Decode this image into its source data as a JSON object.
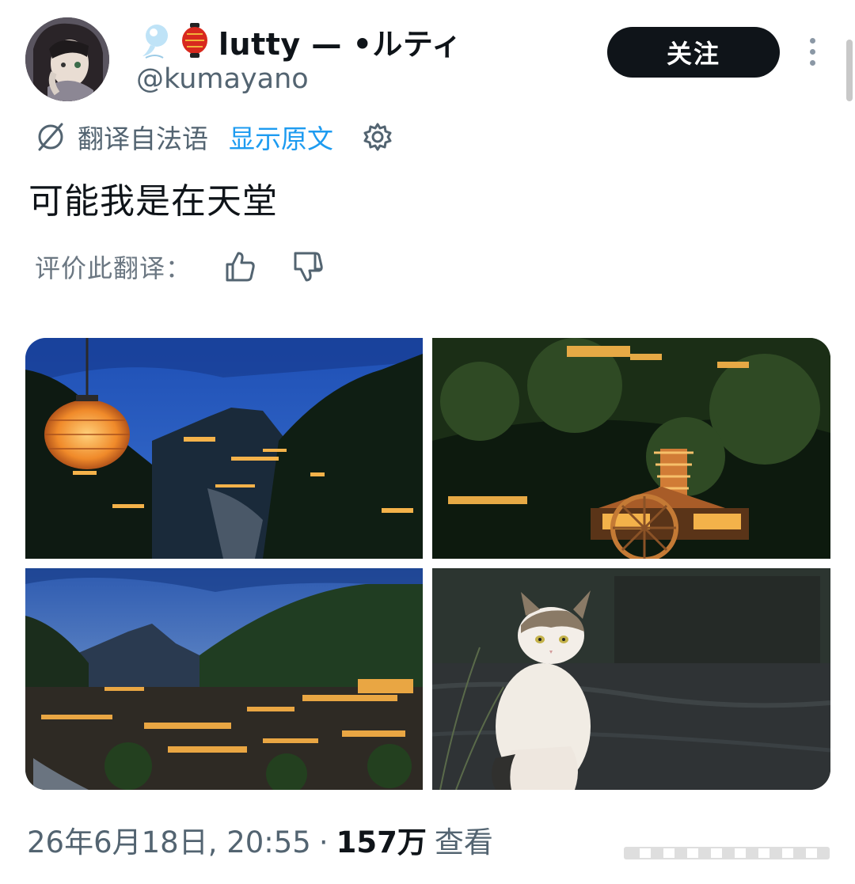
{
  "user": {
    "display_name": "lutty — •ルティ",
    "handle": "@kumayano",
    "emoji": [
      "speech-bubble-icon",
      "red-lantern-icon"
    ]
  },
  "follow_button": {
    "label": "关注"
  },
  "translation": {
    "label": "翻译自法语",
    "show_original": "显示原文"
  },
  "tweet": {
    "text": "可能我是在天堂"
  },
  "rating": {
    "label": "评价此翻译："
  },
  "media": [
    {
      "description_icon": "photo-lantern-mountain-village"
    },
    {
      "description_icon": "photo-night-waterwheel-pagoda"
    },
    {
      "description_icon": "photo-village-dusk-panorama"
    },
    {
      "description_icon": "photo-cat"
    }
  ],
  "footer": {
    "timestamp": "26年6月18日, 20:55",
    "separator": "·",
    "views_count": "157万",
    "views_label": "查看"
  },
  "colors": {
    "accent": "#1d9bf0",
    "text": "#0f1419",
    "secondary": "#536471",
    "button_bg": "#0f1419"
  }
}
